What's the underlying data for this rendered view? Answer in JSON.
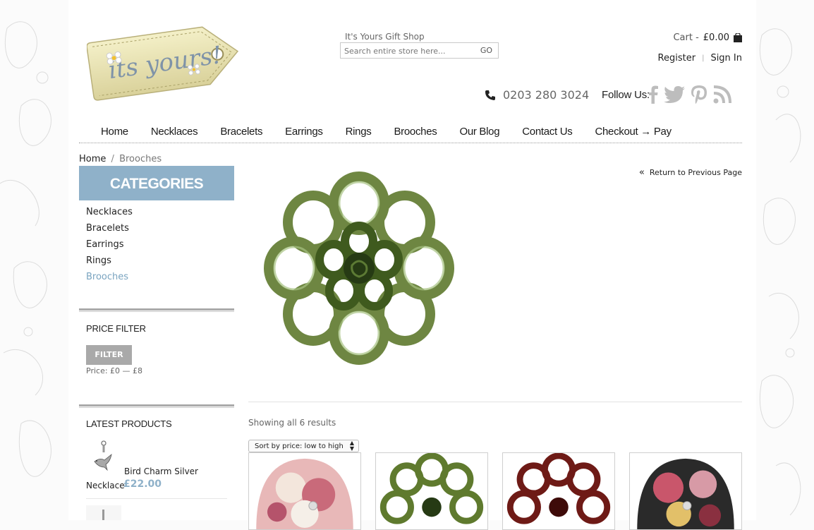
{
  "header": {
    "shop_name": "It's Yours Gift Shop",
    "search_placeholder": "Search entire store here...",
    "search_button": "GO",
    "cart_label": "Cart -",
    "cart_amount": "£0.00",
    "register": "Register",
    "sign_in": "Sign In",
    "phone": "0203 280 3024",
    "follow_label": "Follow Us:"
  },
  "nav": {
    "items": [
      "Home",
      "Necklaces",
      "Bracelets",
      "Earrings",
      "Rings",
      "Brooches",
      "Our Blog",
      "Contact Us",
      "Checkout → Pay"
    ]
  },
  "breadcrumb": {
    "home": "Home",
    "separator": "/",
    "current": "Brooches"
  },
  "sidebar": {
    "categories_title": "CATEGORIES",
    "categories": [
      "Necklaces",
      "Bracelets",
      "Earrings",
      "Rings",
      "Brooches"
    ],
    "active_category": "Brooches",
    "price_filter_title": "PRICE FILTER",
    "filter_button": "FILTER",
    "price_range": "Price: £0 — £8",
    "latest_title": "LATEST PRODUCTS",
    "latest": [
      {
        "name_line1": "Bird Charm Silver",
        "name_line2": "Necklace",
        "price": "£22.00"
      }
    ]
  },
  "main": {
    "return_link": "Return to Previous Page",
    "showing": "Showing all 6 results",
    "sort_selected": "Sort by price: low to high"
  },
  "colors": {
    "accent_blue": "#8fb1c9",
    "link_active": "#7aa4c0",
    "filter_button": "#a9a9a9"
  }
}
